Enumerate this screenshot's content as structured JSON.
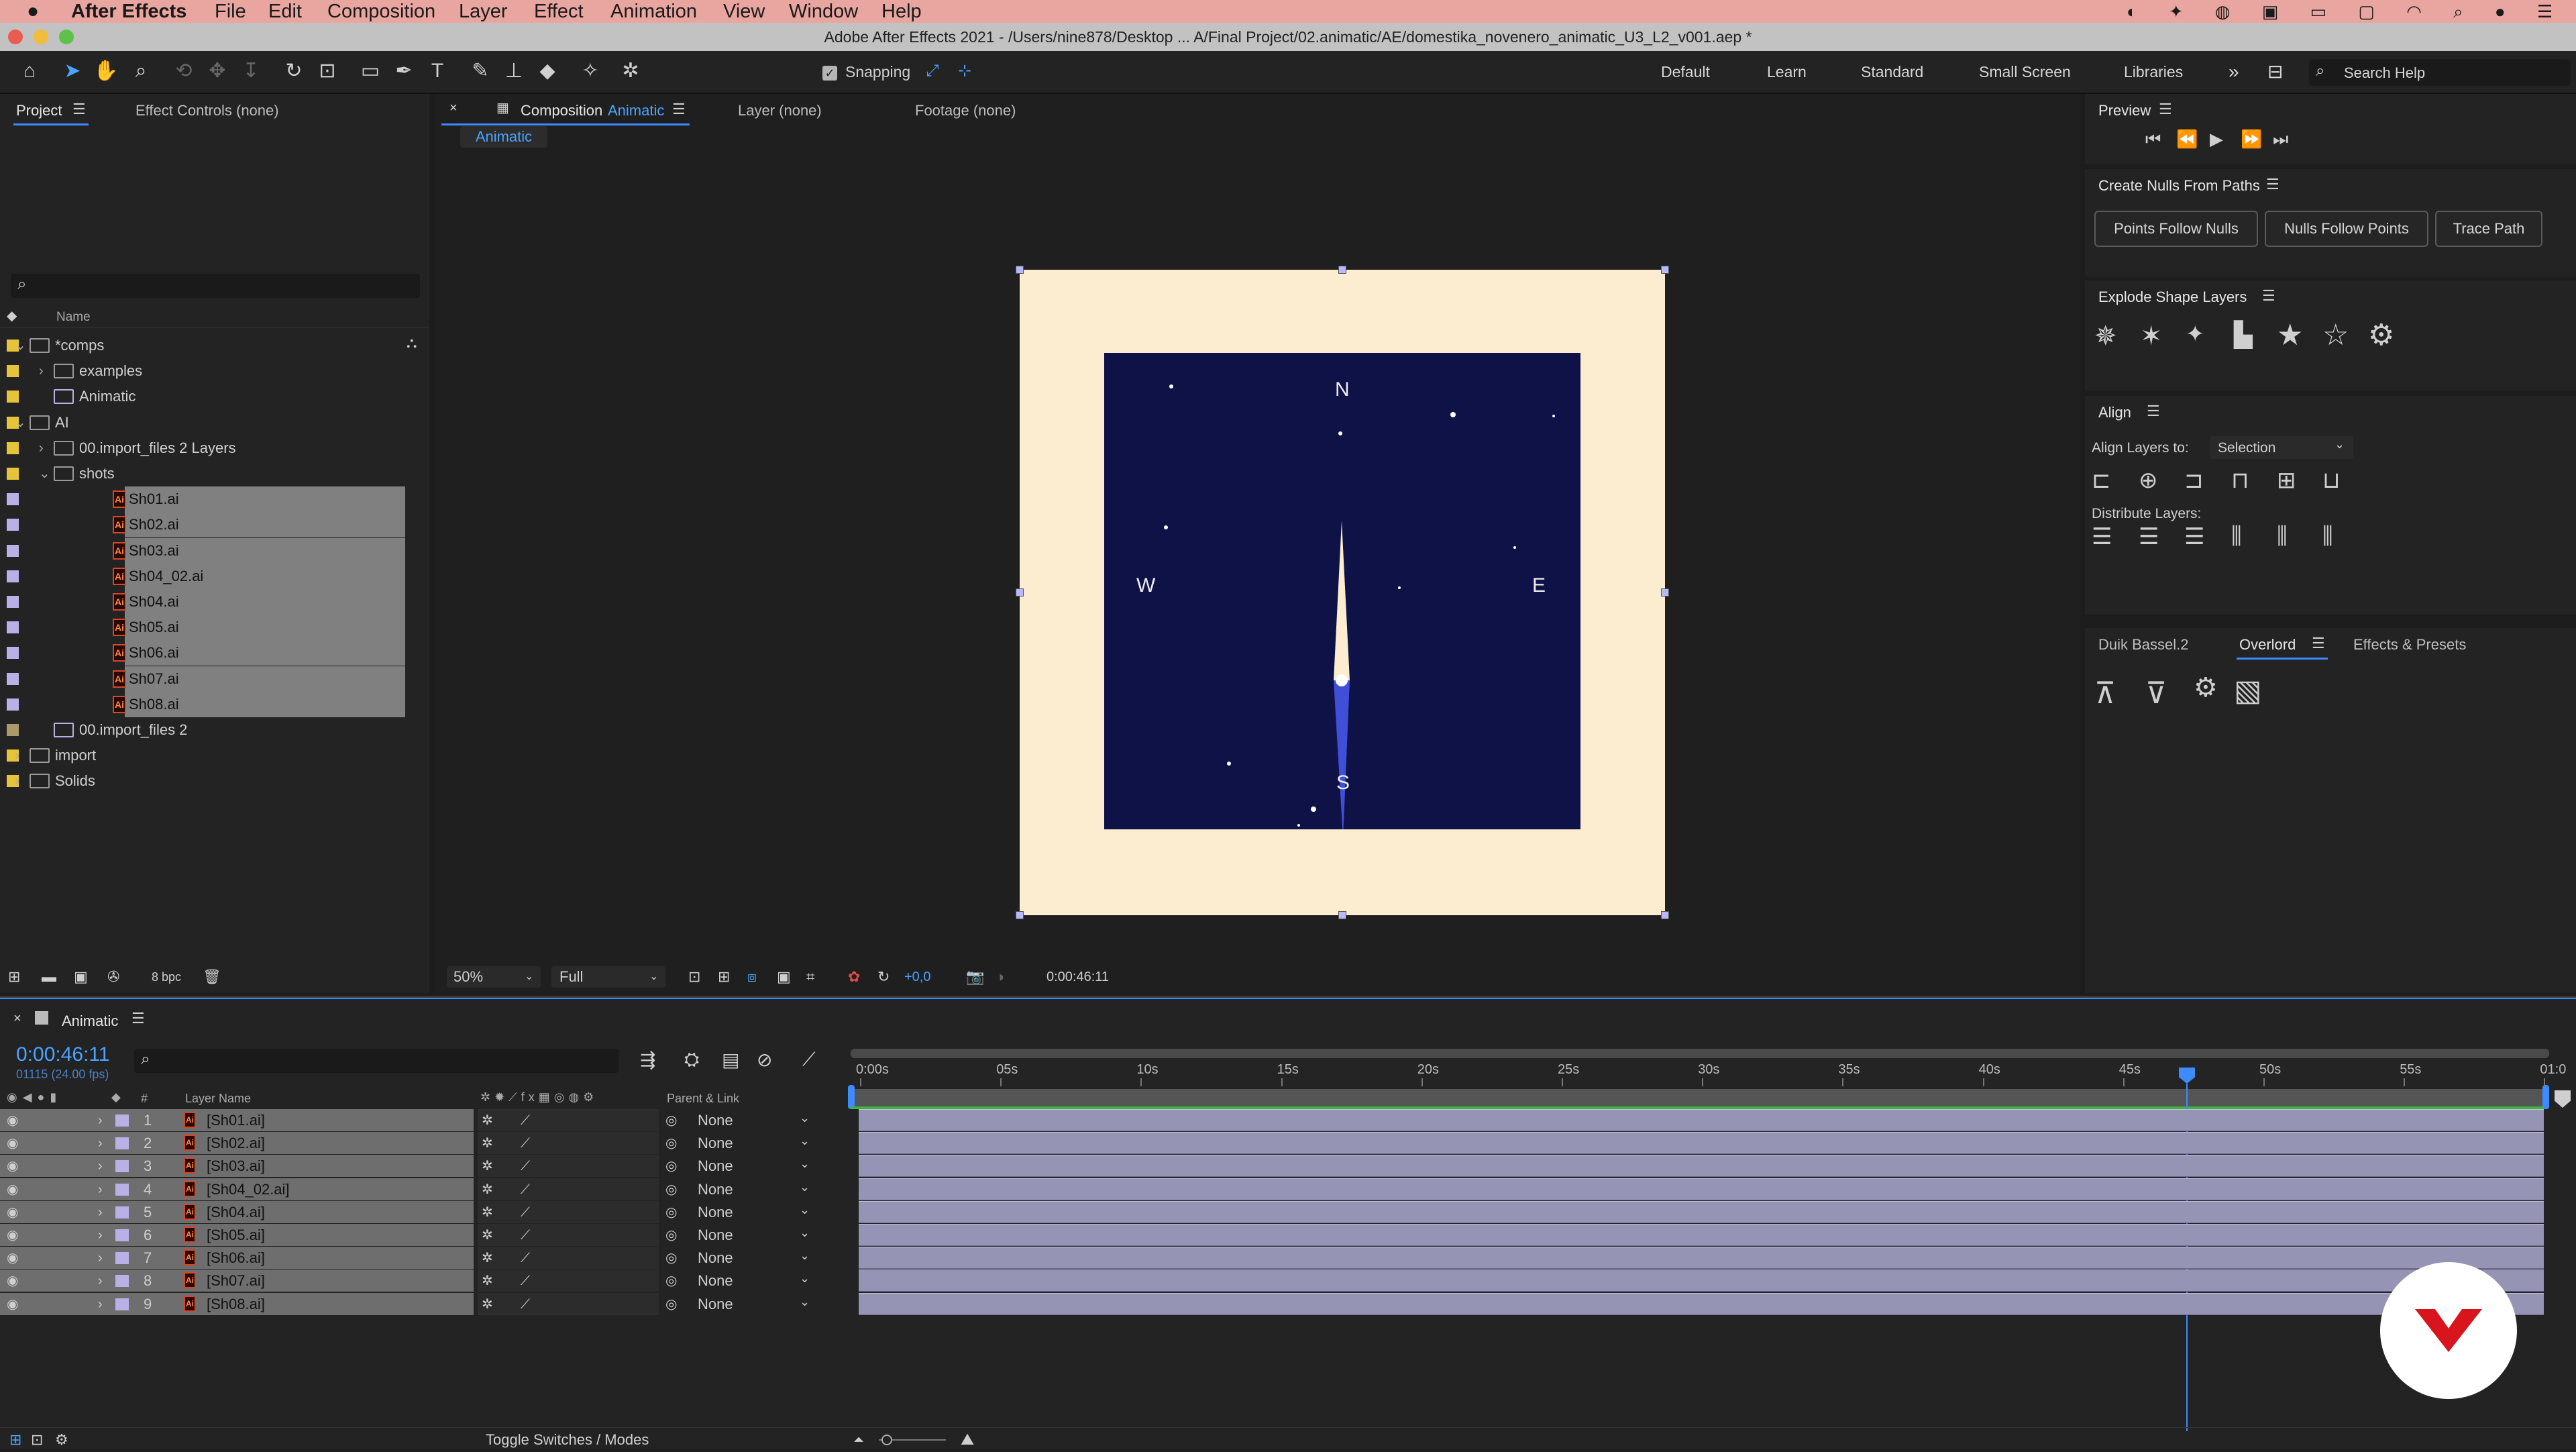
{
  "menu": {
    "app": "After Effects",
    "items": [
      "File",
      "Edit",
      "Composition",
      "Layer",
      "Effect",
      "Animation",
      "View",
      "Window",
      "Help"
    ]
  },
  "window_title": "Adobe After Effects 2021 - /Users/nine878/Desktop ... A/Final Project/02.animatic/AE/domestika_novenero_animatic_U3_L2_v001.aep *",
  "toolbar": {
    "snapping": "Snapping",
    "workspaces": [
      "Default",
      "Learn",
      "Standard",
      "Small Screen",
      "Libraries"
    ],
    "search_placeholder": "Search Help"
  },
  "project": {
    "tab": "Project",
    "effect_controls": "Effect Controls (none)",
    "name_header": "Name",
    "bpc": "8 bpc",
    "items": [
      {
        "name": "*comps",
        "swatch": "#e6c43a",
        "type": "folder",
        "expanded": true
      },
      {
        "name": "examples",
        "swatch": "#e6c43a",
        "type": "folder",
        "expanded": false
      },
      {
        "name": "Animatic",
        "swatch": "#e6c43a",
        "type": "comp"
      },
      {
        "name": "AI",
        "swatch": "#e6c43a",
        "type": "folder",
        "expanded": true
      },
      {
        "name": "00.import_files 2 Layers",
        "swatch": "#e6c43a",
        "type": "folder",
        "expanded": false
      },
      {
        "name": "shots",
        "swatch": "#e6c43a",
        "type": "folder",
        "expanded": true
      },
      {
        "name": "Sh01.ai",
        "swatch": "#b9b1e6",
        "type": "ai",
        "selected": true
      },
      {
        "name": "Sh02.ai",
        "swatch": "#b9b1e6",
        "type": "ai",
        "selected": true
      },
      {
        "name": "Sh03.ai",
        "swatch": "#b9b1e6",
        "type": "ai",
        "selected": true
      },
      {
        "name": "Sh04_02.ai",
        "swatch": "#b9b1e6",
        "type": "ai",
        "selected": true
      },
      {
        "name": "Sh04.ai",
        "swatch": "#b9b1e6",
        "type": "ai",
        "selected": true
      },
      {
        "name": "Sh05.ai",
        "swatch": "#b9b1e6",
        "type": "ai",
        "selected": true
      },
      {
        "name": "Sh06.ai",
        "swatch": "#b9b1e6",
        "type": "ai",
        "selected": true
      },
      {
        "name": "Sh07.ai",
        "swatch": "#b9b1e6",
        "type": "ai",
        "selected": true
      },
      {
        "name": "Sh08.ai",
        "swatch": "#b9b1e6",
        "type": "ai",
        "selected": true
      },
      {
        "name": "00.import_files 2",
        "swatch": "#a89a6a",
        "type": "comp"
      },
      {
        "name": "import",
        "swatch": "#e6c43a",
        "type": "folder",
        "expanded": false
      },
      {
        "name": "Solids",
        "swatch": "#e6c43a",
        "type": "folder",
        "expanded": false
      }
    ]
  },
  "viewer": {
    "comp_tab": "Composition",
    "comp_name": "Animatic",
    "layer_tab": "Layer (none)",
    "footage_tab": "Footage (none)",
    "breadcrumb": "Animatic",
    "zoom": "50%",
    "resolution": "Full",
    "exposure": "+0,0",
    "timecode": "0:00:46:11",
    "compass": {
      "n": "N",
      "s": "S",
      "e": "E",
      "w": "W"
    },
    "bg": "#fcecd0",
    "sky": "#0f1247"
  },
  "right": {
    "preview": "Preview",
    "nulls": {
      "title": "Create Nulls From Paths",
      "b1": "Points Follow Nulls",
      "b2": "Nulls Follow Points",
      "b3": "Trace Path"
    },
    "explode": "Explode Shape Layers",
    "align": {
      "title": "Align",
      "to_label": "Align Layers to:",
      "to_value": "Selection",
      "distribute": "Distribute Layers:"
    },
    "tabs": {
      "duik": "Duik Bassel.2",
      "overlord": "Overlord",
      "effects": "Effects & Presets"
    }
  },
  "timeline": {
    "comp": "Animatic",
    "time": "0:00:46:11",
    "frames": "01115 (24.00 fps)",
    "col_layer": "Layer Name",
    "col_parent": "Parent & Link",
    "col_num": "#",
    "ticks": [
      "0:00s",
      "05s",
      "10s",
      "15s",
      "20s",
      "25s",
      "30s",
      "35s",
      "40s",
      "45s",
      "50s",
      "55s",
      "01:0"
    ],
    "layers": [
      {
        "n": "1",
        "name": "[Sh01.ai]",
        "parent": "None"
      },
      {
        "n": "2",
        "name": "[Sh02.ai]",
        "parent": "None"
      },
      {
        "n": "3",
        "name": "[Sh03.ai]",
        "parent": "None"
      },
      {
        "n": "4",
        "name": "[Sh04_02.ai]",
        "parent": "None"
      },
      {
        "n": "5",
        "name": "[Sh04.ai]",
        "parent": "None"
      },
      {
        "n": "6",
        "name": "[Sh05.ai]",
        "parent": "None"
      },
      {
        "n": "7",
        "name": "[Sh06.ai]",
        "parent": "None"
      },
      {
        "n": "8",
        "name": "[Sh07.ai]",
        "parent": "None"
      },
      {
        "n": "9",
        "name": "[Sh08.ai]",
        "parent": "None"
      }
    ],
    "toggle": "Toggle Switches / Modes"
  }
}
